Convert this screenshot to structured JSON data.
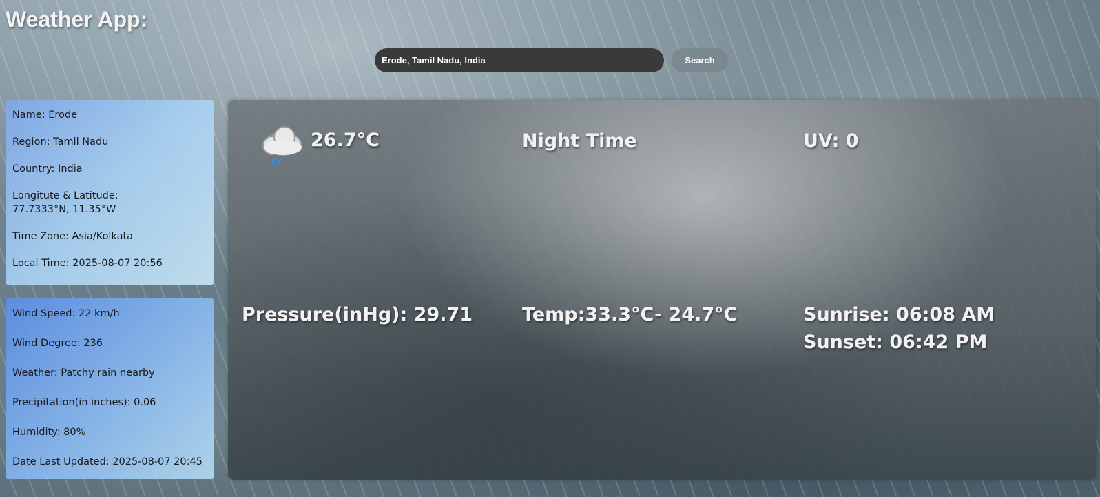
{
  "app": {
    "title": "Weather App:"
  },
  "search": {
    "value": "Erode, Tamil Nadu, India",
    "button_label": "Search"
  },
  "location_card": {
    "name": "Name: Erode",
    "region": "Region: Tamil Nadu",
    "country": "Country: India",
    "coords_label": "Longitute & Latitude:",
    "coords_value": "77.7333°N, 11.35°W",
    "timezone": "Time Zone: Asia/Kolkata",
    "local_time": "Local Time: 2025-08-07 20:56"
  },
  "weather_card": {
    "wind_speed": "Wind Speed: 22 km/h",
    "wind_degree": "Wind Degree: 236",
    "condition": "Weather: Patchy rain nearby",
    "precipitation": "Precipitation(in inches): 0.06",
    "humidity": "Humidity: 80%",
    "last_updated": "Date Last Updated: 2025-08-07 20:45"
  },
  "main": {
    "icon": "moon-cloud-rain-icon",
    "temp_now": "26.7°C",
    "day_night": "Night Time",
    "uv": "UV: 0",
    "pressure": "Pressure(inHg): 29.71",
    "temp_range": "Temp:33.3°C- 24.7°C",
    "sunrise": "Sunrise: 06:08 AM",
    "sunset": "Sunset: 06:42 PM"
  },
  "colors": {
    "search_input_bg": "#3a3a3a",
    "card_gradient_start": "#7fa8ea",
    "card_gradient_end": "#c5e4f3",
    "moon": "#1f6fd1",
    "rain": "#2d8fe8"
  }
}
